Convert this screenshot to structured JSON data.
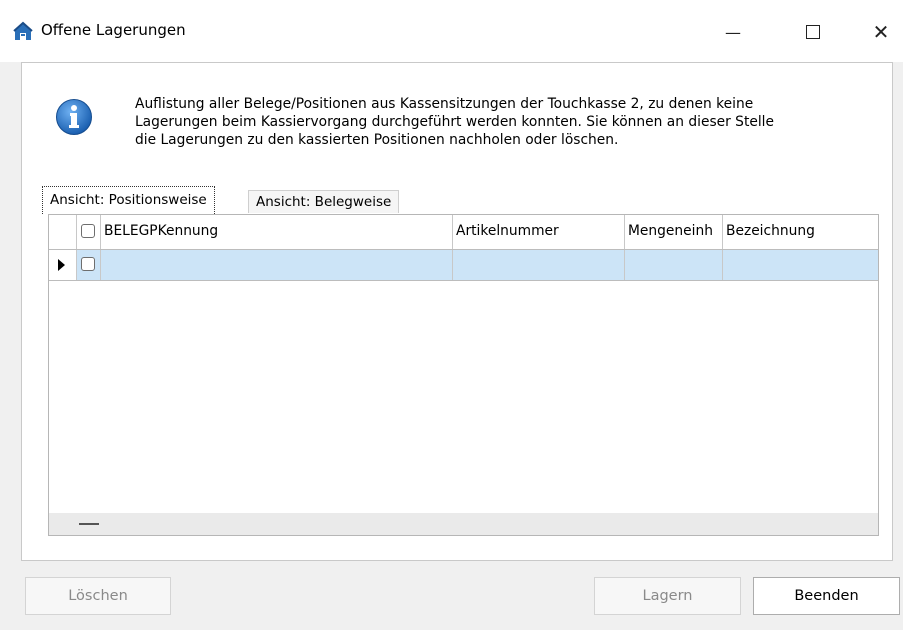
{
  "window": {
    "title": "Offene Lagerungen",
    "minimize_glyph": "—",
    "close_glyph": "✕"
  },
  "info": {
    "icon": "info-icon",
    "lines": [
      "Auflistung aller Belege/Positionen aus Kassensitzungen der Touchkasse 2, zu denen keine",
      "Lagerungen beim Kassiervorgang durchgeführt werden konnten. Sie können an dieser Stelle",
      "die Lagerungen zu den kassierten Positionen nachholen oder löschen."
    ]
  },
  "tabs": [
    {
      "label": "Ansicht: Positionsweise",
      "active": true
    },
    {
      "label": "Ansicht: Belegweise",
      "active": false
    }
  ],
  "grid": {
    "columns": [
      "BELEGPKennung",
      "Artikelnummer",
      "Mengeneinh",
      "Bezeichnung"
    ],
    "rows": [
      [
        "",
        "",
        "",
        ""
      ]
    ],
    "footer_glyph": "—"
  },
  "buttons": {
    "delete": "Löschen",
    "store": "Lagern",
    "close": "Beenden"
  },
  "colors": {
    "selected_row": "#cce4f7",
    "info_blue": "#1f6fbf"
  }
}
